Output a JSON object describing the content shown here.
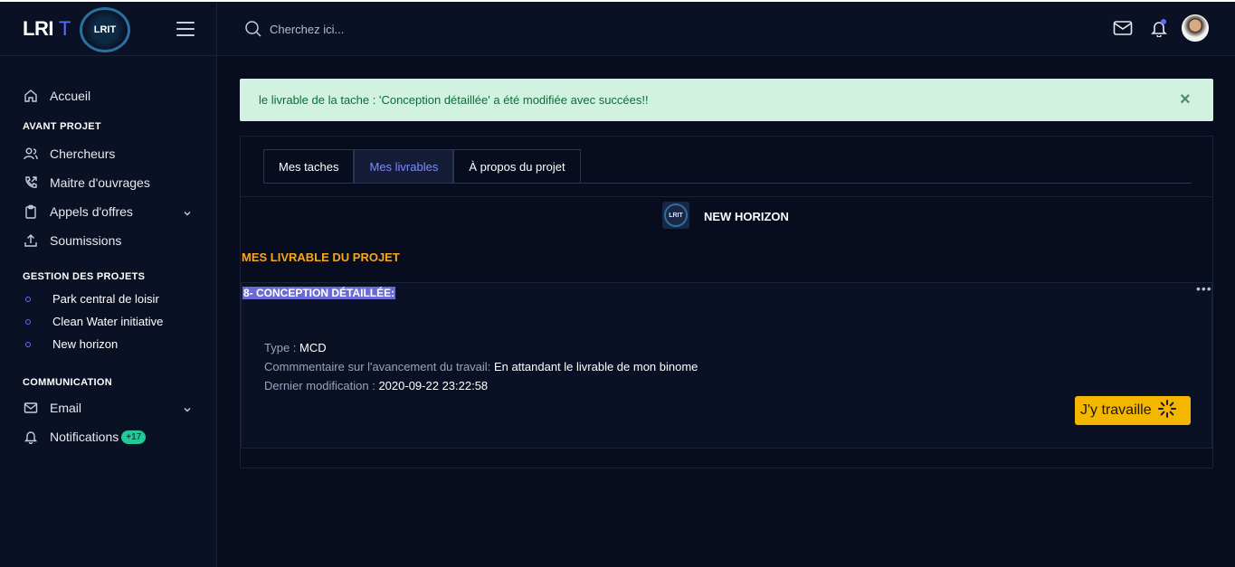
{
  "brand": {
    "name": "LRI",
    "suffix": "T",
    "logo_text": "LRIT"
  },
  "sidebar": {
    "home": "Accueil",
    "section_avant": "AVANT PROJET",
    "avant_items": [
      "Chercheurs",
      "Maitre d'ouvrages",
      "Appels d'offres",
      "Soumissions"
    ],
    "section_gestion": "GESTION DES PROJETS",
    "projects": [
      "Park central de loisir",
      "Clean Water initiative",
      "New horizon"
    ],
    "section_comm": "COMMUNICATION",
    "email": "Email",
    "notifications": "Notifications",
    "notif_badge": "+17"
  },
  "header": {
    "search_placeholder": "Cherchez ici..."
  },
  "alert": {
    "message": "le livrable de la tache : 'Conception détaillée' a été modifiée avec succées!!",
    "close": "×"
  },
  "tabs": [
    "Mes taches",
    "Mes livrables",
    "À propos du projet"
  ],
  "project": {
    "name": "NEW HORIZON",
    "logo_text": "LRIT"
  },
  "section_heading": "MES LIVRABLE DU PROJET",
  "deliverable": {
    "title": "8- CONCEPTION DÉTAILLÉE:",
    "type_label": "Type :",
    "type_value": "MCD",
    "comment_label": "Commmentaire sur l'avancement du travail:",
    "comment_value": "En attandant le livrable de mon binome",
    "modified_label": "Dernier modification :",
    "modified_value": "2020-09-22 23:22:58",
    "button": "J'y travaille"
  },
  "colors": {
    "accent": "#5b6cff",
    "warning": "#f5b600",
    "success_bg": "#d1f2e0",
    "heading": "#f5a623"
  }
}
